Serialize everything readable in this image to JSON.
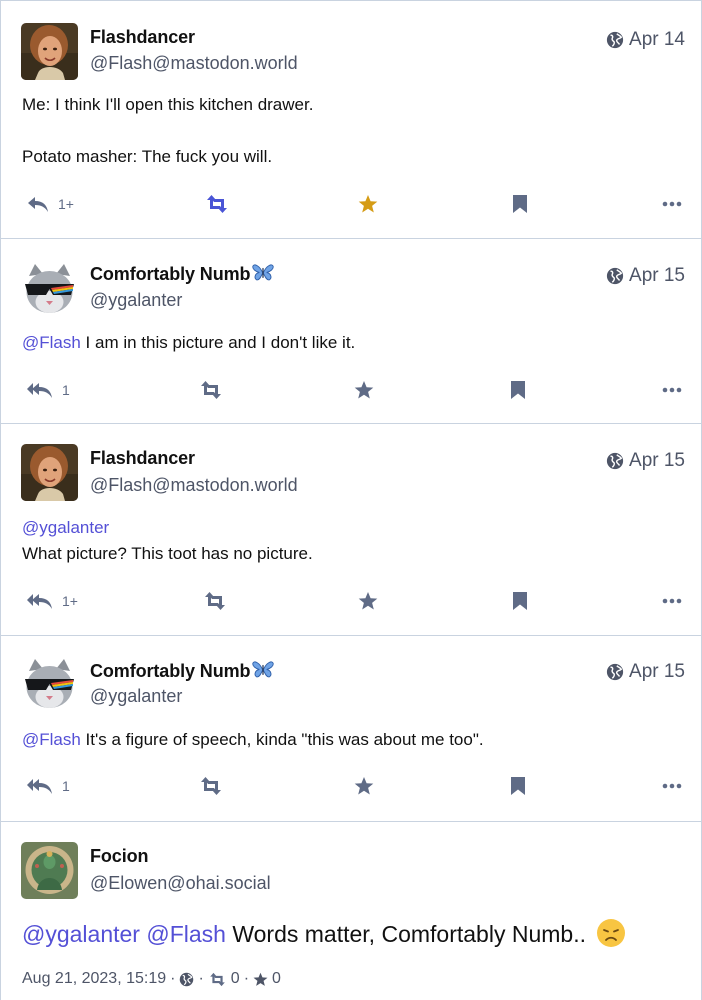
{
  "posts": [
    {
      "name": "Flashdancer",
      "handle": "@Flash@mastodon.world",
      "date": "Apr 14",
      "line1": "Me: I think I'll open this kitchen drawer.",
      "line2": "Potato masher: The fuck you will.",
      "reply_count": "1+",
      "favourited": true
    },
    {
      "name": "Comfortably Numb",
      "handle": "@ygalanter",
      "date": "Apr 15",
      "mention": "@Flash",
      "text": " I am in this picture and I don't like it.",
      "reply_count": "1"
    },
    {
      "name": "Flashdancer",
      "handle": "@Flash@mastodon.world",
      "date": "Apr 15",
      "mention": "@ygalanter",
      "text": "What picture? This toot has no picture.",
      "reply_count": "1+"
    },
    {
      "name": "Comfortably Numb",
      "handle": "@ygalanter",
      "date": "Apr 15",
      "mention": "@Flash",
      "text": " It's a figure of speech, kinda \"this was about me too\".",
      "reply_count": "1"
    },
    {
      "name": "Focion",
      "handle": "@Elowen@ohai.social",
      "mention1": "@ygalanter",
      "mention2": "@Flash",
      "text": " Words matter, Comfortably Numb..",
      "timestamp": "Aug 21, 2023, 15:19",
      "boosts": "0",
      "favourites": "0"
    }
  ],
  "colors": {
    "accent": "#5450d6",
    "icon_gray": "#5f6b86",
    "boost_active": "#4a55d6",
    "star_active": "#d59c16",
    "border": "#c9d3e0"
  },
  "icons": {
    "reply": "reply-icon",
    "reply_all": "reply-all-icon",
    "boost": "boost-icon",
    "favourite": "star-icon",
    "bookmark": "bookmark-icon",
    "more": "more-icon",
    "visibility": "globe-icon"
  }
}
